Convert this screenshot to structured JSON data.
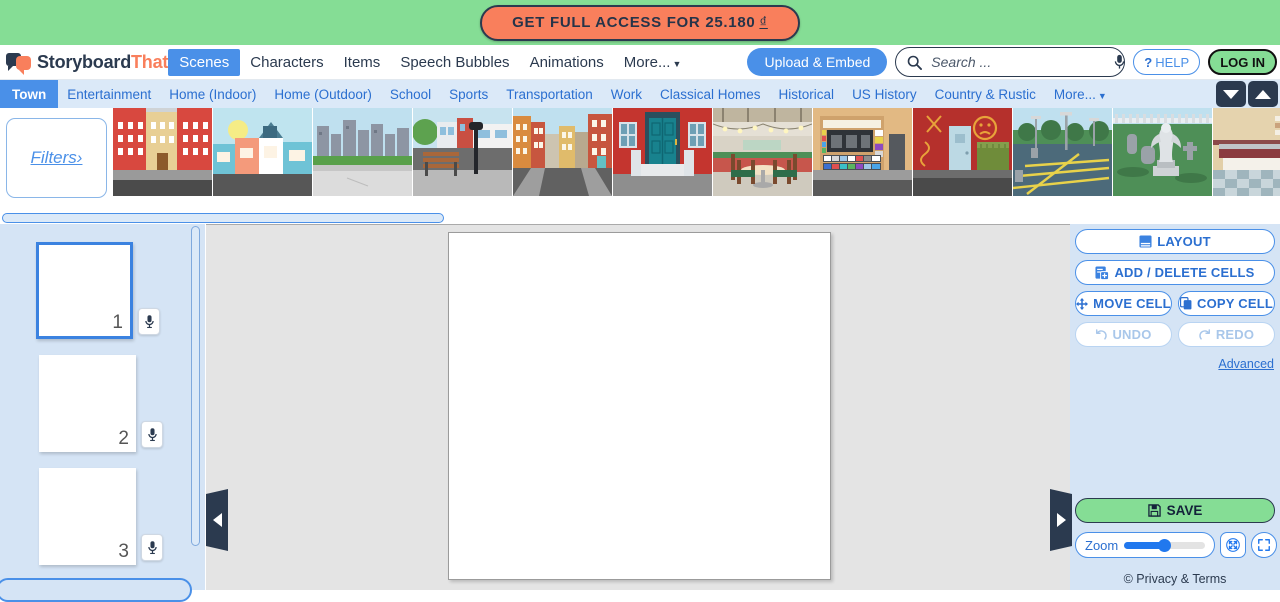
{
  "promo": {
    "label": "GET FULL ACCESS FOR 25.180",
    "currency": "₫"
  },
  "brand": {
    "name_primary": "Storyboard",
    "name_accent": "That"
  },
  "nav": {
    "items": [
      {
        "label": "Scenes",
        "active": true
      },
      {
        "label": "Characters",
        "active": false
      },
      {
        "label": "Items",
        "active": false
      },
      {
        "label": "Speech Bubbles",
        "active": false
      },
      {
        "label": "Animations",
        "active": false
      },
      {
        "label": "More...",
        "active": false,
        "caret": true
      }
    ],
    "upload_label": "Upload & Embed",
    "search": {
      "value": "",
      "placeholder": "Search ..."
    },
    "help_mark": "?",
    "help_label": "HELP",
    "login_label": "LOG IN"
  },
  "categories": {
    "items": [
      {
        "label": "Town",
        "active": true
      },
      {
        "label": "Entertainment",
        "active": false
      },
      {
        "label": "Home (Indoor)",
        "active": false
      },
      {
        "label": "Home (Outdoor)",
        "active": false
      },
      {
        "label": "School",
        "active": false
      },
      {
        "label": "Sports",
        "active": false
      },
      {
        "label": "Transportation",
        "active": false
      },
      {
        "label": "Work",
        "active": false
      },
      {
        "label": "Classical Homes",
        "active": false
      },
      {
        "label": "Historical",
        "active": false
      },
      {
        "label": "US History",
        "active": false
      },
      {
        "label": "Country & Rustic",
        "active": false
      },
      {
        "label": "More...",
        "active": false,
        "caret": true
      }
    ]
  },
  "scenes": {
    "filters_label": "Filters›",
    "thumbnails": [
      {
        "name": "row-of-brick-apartments"
      },
      {
        "name": "small-town-storefronts-sunny"
      },
      {
        "name": "city-skyline-from-rooftop"
      },
      {
        "name": "street-corner-with-bench-lamppost"
      },
      {
        "name": "city-street-between-buildings"
      },
      {
        "name": "red-building-teal-front-door"
      },
      {
        "name": "cafe-patio-with-string-lights"
      },
      {
        "name": "convenience-store-counter"
      },
      {
        "name": "alley-door-with-graffiti-dumpster"
      },
      {
        "name": "empty-parking-lot"
      },
      {
        "name": "cemetery-with-angel-statue"
      },
      {
        "name": "diner-counter-interior"
      }
    ]
  },
  "cells": {
    "items": [
      {
        "number": "1",
        "selected": true
      },
      {
        "number": "2",
        "selected": false
      },
      {
        "number": "3",
        "selected": false
      }
    ],
    "mic_icon": "microphone-icon"
  },
  "tools": {
    "layout_label": "LAYOUT",
    "add_delete_label": "ADD / DELETE CELLS",
    "move_cell_label": "MOVE CELL",
    "copy_cell_label": "COPY CELL",
    "undo_label": "UNDO",
    "redo_label": "REDO",
    "advanced_label": "Advanced",
    "save_label": "SAVE",
    "zoom_label": "Zoom",
    "privacy_label": "© Privacy & Terms"
  },
  "colors": {
    "promo_bg": "#85dd95",
    "promo_btn": "#f97f5c",
    "accent_blue": "#4a90e8",
    "panel_blue": "#d5e4f5",
    "dark_navy": "#2b3a4f",
    "save_green": "#85dd95"
  }
}
